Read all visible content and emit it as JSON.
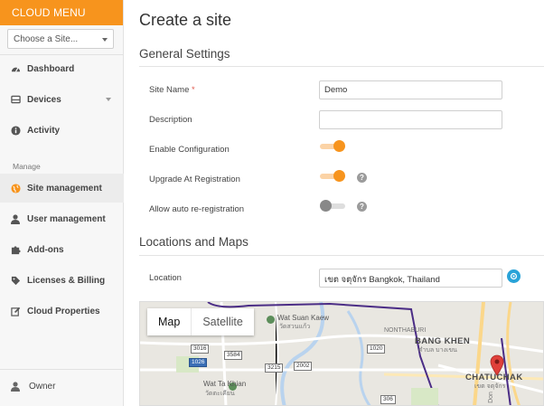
{
  "sidebar": {
    "header": "CLOUD MENU",
    "site_select_placeholder": "Choose a Site...",
    "section_label": "Manage",
    "items": [
      {
        "label": "Dashboard",
        "icon": "dashboard-icon"
      },
      {
        "label": "Devices",
        "icon": "devices-icon"
      },
      {
        "label": "Activity",
        "icon": "info-icon"
      },
      {
        "label": "Site management",
        "icon": "globe-icon"
      },
      {
        "label": "User management",
        "icon": "user-icon"
      },
      {
        "label": "Add-ons",
        "icon": "puzzle-icon"
      },
      {
        "label": "Licenses & Billing",
        "icon": "tag-icon"
      },
      {
        "label": "Cloud Properties",
        "icon": "edit-icon"
      }
    ],
    "owner_label": "Owner",
    "accent_color": "#f7941d"
  },
  "page": {
    "title": "Create a site",
    "general_section": "General Settings",
    "locations_section": "Locations and Maps",
    "fields": {
      "site_name_label": "Site Name",
      "site_name_required_mark": "*",
      "site_name_value": "Demo",
      "description_label": "Description",
      "description_value": "",
      "enable_config_label": "Enable Configuration",
      "enable_config_on": true,
      "upgrade_label": "Upgrade At Registration",
      "upgrade_on": true,
      "auto_reg_label": "Allow auto re-registration",
      "auto_reg_on": false,
      "location_label": "Location",
      "location_value": "เขต จตุจักร Bangkok, Thailand"
    },
    "help_glyph": "?"
  },
  "map": {
    "tab_map": "Map",
    "tab_satellite": "Satellite",
    "labels": {
      "wat_suan_kaew": "Wat Suan Kaew",
      "wat_suan_kaew_th": "วัดสวนแก้ว",
      "nonthaburi": "NONTHABURI",
      "bang_khen": "BANG KHEN",
      "bang_khen_th": "ตำบล บางเขน",
      "wat_ta_khian": "Wat Ta Khian",
      "wat_ta_khian_th": "วัดตะเคียน",
      "chatuchak": "CHATUCHAK",
      "chatuchak_th": "เขต จตุจักร",
      "don": "Don"
    },
    "shields": [
      "3016",
      "3584",
      "1026",
      "3215",
      "2002",
      "1020",
      "306"
    ],
    "marker_color": "#e0403a"
  }
}
